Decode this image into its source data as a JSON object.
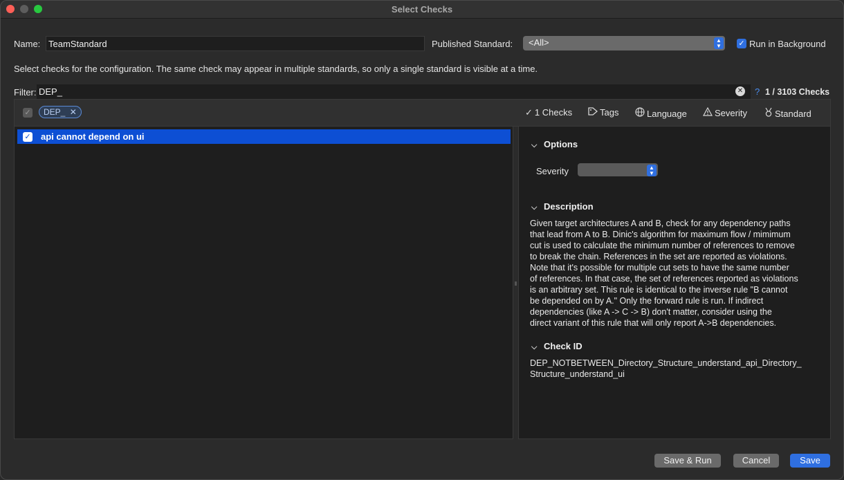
{
  "window": {
    "title": "Select Checks"
  },
  "form": {
    "name_label": "Name:",
    "name_value": "TeamStandard",
    "published_label": "Published Standard:",
    "published_value": "<All>",
    "run_background_label": "Run in Background",
    "instructions": "Select checks for the configuration. The same check may appear in multiple standards, so only a single standard is visible at a time."
  },
  "filter": {
    "label": "Filter:",
    "value": "DEP_",
    "help": "?",
    "count": "1 / 3103 Checks"
  },
  "toolbar": {
    "chip": "DEP_",
    "checks": "1 Checks",
    "tags": "Tags",
    "language": "Language",
    "severity": "Severity",
    "standard": "Standard"
  },
  "list": {
    "items": [
      {
        "label": "api cannot depend on ui",
        "checked": true
      }
    ]
  },
  "details": {
    "options_header": "Options",
    "severity_label": "Severity",
    "description_header": "Description",
    "description_lines": [
      "Given target architectures A and B, check for any dependency paths",
      "that lead from A to B. Dinic's algorithm for maximum flow / mimimum",
      "cut is used to calculate the minimum number of references to remove",
      "to break the chain. References in the set are reported as violations.",
      "Note that it's possible for multiple cut sets to have the same number",
      "of references. In that case, the set of references reported as violations",
      "is an arbitrary set. This rule is identical to the inverse rule \"B cannot",
      "be depended on by A.\" Only the forward rule is run. If indirect",
      "dependencies (like A -> C -> B) don't matter, consider using the",
      "direct variant of this rule that will only report A->B dependencies."
    ],
    "check_id_header": "Check ID",
    "check_id_lines": [
      "DEP_NOTBETWEEN_Directory_Structure_understand_api_Directory_",
      "Structure_understand_ui"
    ]
  },
  "buttons": {
    "save_run": "Save & Run",
    "cancel": "Cancel",
    "save": "Save"
  },
  "colors": {
    "accent": "#2f6fe0",
    "selection": "#0d4fd4",
    "background": "#2b2b2b"
  }
}
